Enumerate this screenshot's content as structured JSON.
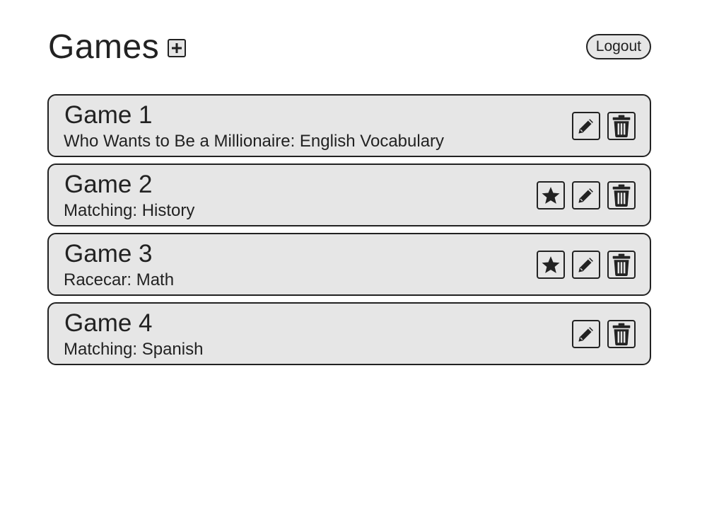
{
  "header": {
    "title": "Games",
    "add_icon": "plus-square-icon",
    "logout_label": "Logout"
  },
  "games": [
    {
      "name": "Game 1",
      "description": "Who Wants to Be a Millionaire: English Vocabulary",
      "starred": false
    },
    {
      "name": "Game 2",
      "description": "Matching: History",
      "starred": true
    },
    {
      "name": "Game 3",
      "description": "Racecar: Math",
      "starred": true
    },
    {
      "name": "Game 4",
      "description": "Matching: Spanish",
      "starred": false
    }
  ],
  "icons": {
    "star": "star-icon",
    "edit": "pencil-icon",
    "delete": "trash-icon"
  },
  "colors": {
    "card_background": "#e6e6e6",
    "border": "#222222",
    "text": "#222222",
    "page_background": "#ffffff"
  }
}
